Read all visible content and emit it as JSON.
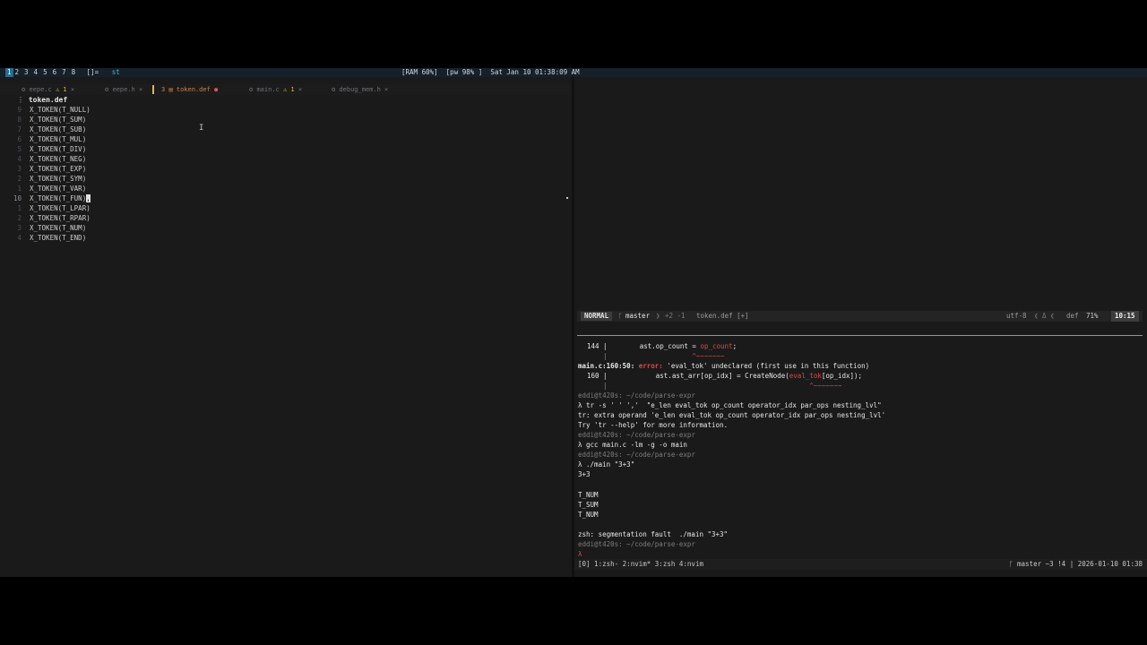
{
  "topbar": {
    "workspaces": [
      "1",
      "2",
      "3",
      "4",
      "5",
      "6",
      "7",
      "8"
    ],
    "active_workspace": "1",
    "layout": "[]=",
    "window_title": "st",
    "status": "[RAM 60%]  [pw 98% ]  Sat Jan 10 01:38:09 AM"
  },
  "tabs": [
    {
      "label": "eepe.c",
      "badge": "⚠ 1",
      "close": "×"
    },
    {
      "label": "eepe.h",
      "badge": "",
      "close": "×"
    },
    {
      "label": "token.def",
      "prefix": "3",
      "badge": "●",
      "close": ""
    },
    {
      "label": "main.c",
      "badge": "⚠ 1",
      "close": "×"
    },
    {
      "label": "debug_mem.h",
      "badge": "",
      "close": "×"
    }
  ],
  "editor": {
    "file_title": "token.def",
    "lines": [
      {
        "ln": "9",
        "text": "X_TOKEN(T_NULL)"
      },
      {
        "ln": "8",
        "text": "X_TOKEN(T_SUM)"
      },
      {
        "ln": "7",
        "text": "X_TOKEN(T_SUB)"
      },
      {
        "ln": "6",
        "text": "X_TOKEN(T_MUL)"
      },
      {
        "ln": "5",
        "text": "X_TOKEN(T_DIV)"
      },
      {
        "ln": "4",
        "text": "X_TOKEN(T_NEG)"
      },
      {
        "ln": "3",
        "text": "X_TOKEN(T_EXP)"
      },
      {
        "ln": "2",
        "text": "X_TOKEN(T_SYM)"
      },
      {
        "ln": "1",
        "text": "X_TOKEN(T_VAR)"
      },
      {
        "ln": "10",
        "text": "X_TOKEN(T_FUN)",
        "cursor": ","
      },
      {
        "ln": "1",
        "text": "X_TOKEN(T_LPAR)"
      },
      {
        "ln": "2",
        "text": "X_TOKEN(T_RPAR)"
      },
      {
        "ln": "3",
        "text": "X_TOKEN(T_NUM)"
      },
      {
        "ln": "4",
        "text": "X_TOKEN(T_END)"
      }
    ]
  },
  "statusline": {
    "mode": "NORMAL",
    "branch": "master",
    "diff": "+2 -1",
    "file": "token.def [+]",
    "encoding": "utf-8",
    "filetype": "def",
    "percent": "71%",
    "position": "10:15"
  },
  "terminal": {
    "l1_num": "144 |",
    "l1_code": "        ast.op_count = ",
    "l1_hl": "op_count",
    "l1_end": ";",
    "l2_pipe": "    |",
    "l2_caret": "                     ^~~~~~~~",
    "l3_loc": "main.c:160:50:",
    "l3_err": " error: ",
    "l3_msg": "'eval_tok' undeclared (first use in this function)",
    "l4_num": "160 |",
    "l4_code": "            ast.ast_arr[op_idx] = CreateNode(",
    "l4_hl": "eval_tok",
    "l4_end": "[op_idx]);",
    "l5_pipe": "    |",
    "l5_caret": "                                                  ^~~~~~~~",
    "prompt1": "eddi@t420s: ~/code/parse-expr",
    "cmd1": "λ tr -s ' ' ','  \"e_len eval_tok op_count operator_idx par_ops nesting_lvl\"",
    "out1": "tr: extra operand 'e_len eval_tok op_count operator_idx par_ops nesting_lvl'",
    "out2": "Try 'tr --help' for more information.",
    "prompt2": "eddi@t420s: ~/code/parse-expr",
    "cmd2": "λ gcc main.c -lm -g -o main",
    "prompt3": "eddi@t420s: ~/code/parse-expr",
    "cmd3": "λ ./main \"3+3\"",
    "out3": "3+3",
    "out4": "T_NUM",
    "out5": "T_SUM",
    "out6": "T_NUM",
    "out7": "zsh: segmentation fault  ./main \"3+3\"",
    "prompt4": "eddi@t420s: ~/code/parse-expr",
    "cmd4": "λ"
  },
  "tmux": {
    "windows": "[0] 1:zsh- 2:nvim* 3:zsh  4:nvim",
    "right": "ᚴ master ~3 !4  |  2026-01-10 01:38"
  }
}
